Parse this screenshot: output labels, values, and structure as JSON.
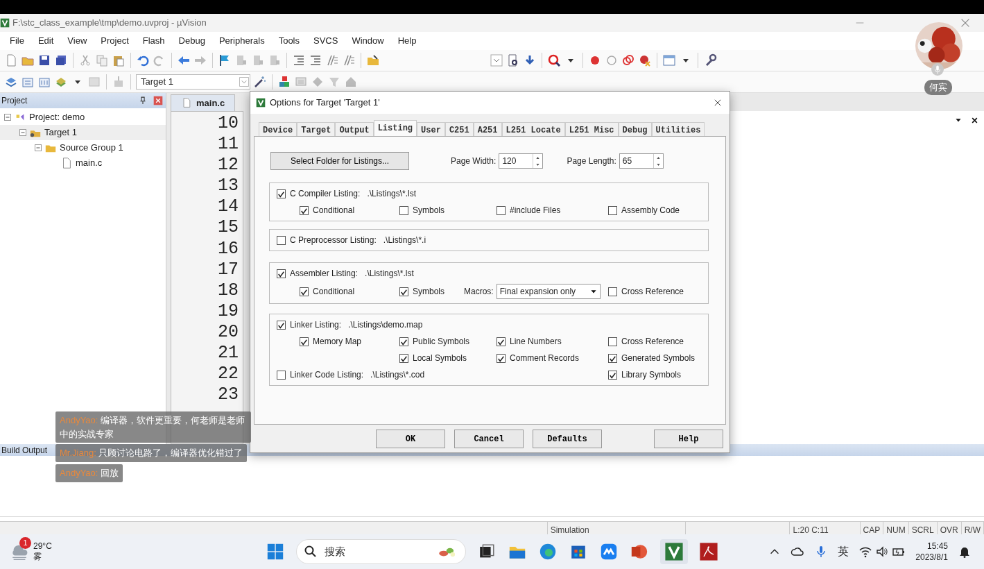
{
  "window": {
    "title": "F:\\stc_class_example\\tmp\\demo.uvproj - µVision"
  },
  "menu": [
    "File",
    "Edit",
    "View",
    "Project",
    "Flash",
    "Debug",
    "Peripherals",
    "Tools",
    "SVCS",
    "Window",
    "Help"
  ],
  "toolbar": {
    "target": "Target 1"
  },
  "project_panel": {
    "title": "Project",
    "tree": [
      {
        "label": "Project: demo",
        "kind": "project",
        "expanded": true,
        "selected": false,
        "children": [
          {
            "label": "Target 1",
            "kind": "target",
            "expanded": true,
            "selected": true,
            "children": [
              {
                "label": "Source Group 1",
                "kind": "group",
                "expanded": true,
                "selected": false,
                "children": [
                  {
                    "label": "main.c",
                    "kind": "file",
                    "selected": false
                  }
                ]
              }
            ]
          }
        ]
      }
    ]
  },
  "editor": {
    "tab": "main.c",
    "line_numbers": [
      "10",
      "11",
      "12",
      "13",
      "14",
      "15",
      "16",
      "17",
      "18",
      "19",
      "20",
      "21",
      "22",
      "23"
    ]
  },
  "dialog": {
    "title": "Options for Target 'Target 1'",
    "tabs": [
      {
        "label": "Device",
        "selected": false
      },
      {
        "label": "Target",
        "selected": false
      },
      {
        "label": "Output",
        "selected": false
      },
      {
        "label": "Listing",
        "selected": true
      },
      {
        "label": "User",
        "selected": false
      },
      {
        "label": "C251",
        "selected": false
      },
      {
        "label": "A251",
        "selected": false
      },
      {
        "label": "L251 Locate",
        "selected": false
      },
      {
        "label": "L251 Misc",
        "selected": false
      },
      {
        "label": "Debug",
        "selected": false
      },
      {
        "label": "Utilities",
        "selected": false
      }
    ],
    "folder_button": "Select Folder for Listings...",
    "page_width": {
      "label": "Page Width:",
      "value": "120"
    },
    "page_length": {
      "label": "Page Length:",
      "value": "65"
    },
    "groups": [
      {
        "main": {
          "label": "C Compiler Listing:",
          "path": ".\\Listings\\*.lst",
          "checked": true
        },
        "rows": [
          [
            {
              "kind": "checkbox",
              "label": "Conditional",
              "checked": true
            },
            {
              "kind": "checkbox",
              "label": "Symbols",
              "checked": false
            },
            {
              "kind": "checkbox",
              "label": "#include Files",
              "checked": false
            },
            {
              "kind": "checkbox",
              "label": "Assembly Code",
              "checked": false
            }
          ]
        ]
      },
      {
        "main": {
          "label": "C Preprocessor Listing:",
          "path": ".\\Listings\\*.i",
          "checked": false
        }
      },
      {
        "main": {
          "label": "Assembler Listing:",
          "path": ".\\Listings\\*.lst",
          "checked": true
        },
        "rows": [
          [
            {
              "kind": "checkbox",
              "label": "Conditional",
              "checked": true
            },
            {
              "kind": "checkbox",
              "label": "Symbols",
              "checked": true
            },
            {
              "kind": "select",
              "label": "Macros:",
              "value": "Final expansion only"
            },
            {
              "kind": "checkbox",
              "label": "Cross Reference",
              "checked": false
            }
          ]
        ]
      },
      {
        "main": {
          "label": "Linker Listing:",
          "path": ".\\Listings\\demo.map",
          "checked": true
        },
        "rows": [
          [
            {
              "kind": "checkbox",
              "label": "Memory Map",
              "checked": true
            },
            {
              "kind": "checkbox",
              "label": "Public Symbols",
              "checked": true
            },
            {
              "kind": "checkbox",
              "label": "Line Numbers",
              "checked": true
            },
            {
              "kind": "checkbox",
              "label": "Cross Reference",
              "checked": false
            }
          ],
          [
            "",
            {
              "kind": "checkbox",
              "label": "Local Symbols",
              "checked": true
            },
            {
              "kind": "checkbox",
              "label": "Comment Records",
              "checked": true
            },
            {
              "kind": "checkbox",
              "label": "Generated Symbols",
              "checked": true
            }
          ],
          [
            {
              "kind": "path_checkbox",
              "label": "Linker Code Listing:",
              "path": ".\\Listings\\*.cod",
              "checked": false
            },
            "",
            "",
            {
              "kind": "checkbox",
              "label": "Library Symbols",
              "checked": true
            }
          ]
        ]
      }
    ],
    "buttons": [
      "OK",
      "Cancel",
      "Defaults",
      "Help"
    ]
  },
  "build_output": {
    "title": "Build Output"
  },
  "status_bar": {
    "mode": "Simulation",
    "position": "L:20 C:11",
    "indicators": [
      "CAP",
      "NUM",
      "SCRL",
      "OVR",
      "R/W"
    ]
  },
  "stream_overlay": {
    "host_name": "何宾",
    "chat": [
      {
        "author": "AndyYao:",
        "text": "编译器，软件更重要，何老师是老师中的实战专家"
      },
      {
        "author": "Mr.Jiang:",
        "text": "只顾讨论电路了，编译器优化错过了"
      },
      {
        "author": "AndyYao:",
        "text": "回放"
      }
    ]
  },
  "taskbar": {
    "weather": {
      "badge": "1",
      "temperature": "29°C",
      "condition": "雾"
    },
    "search_placeholder": "搜索",
    "ime": "英",
    "time": "15:45",
    "date": "2023/8/1"
  }
}
